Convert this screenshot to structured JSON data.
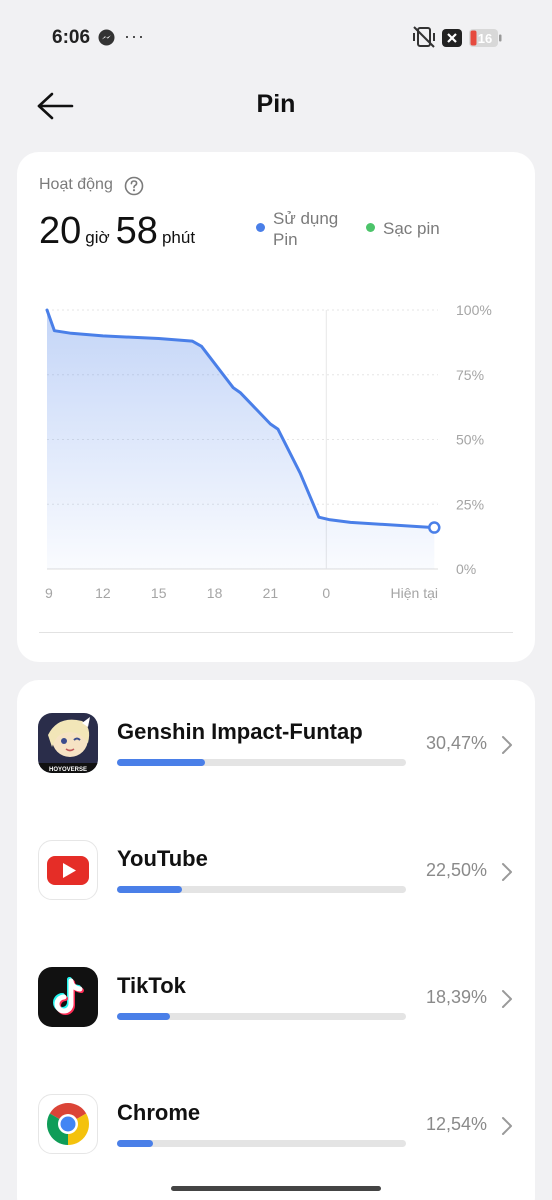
{
  "status_bar": {
    "time": "6:06",
    "icons": [
      "messenger-icon",
      "more-dots-icon",
      "vibrate-off-icon",
      "close-box-icon",
      "battery-icon"
    ],
    "battery_level": "16"
  },
  "header": {
    "title": "Pin",
    "back_icon": "arrow-left-icon"
  },
  "summary": {
    "label": "Hoạt động",
    "hours": "20",
    "hours_unit": "giờ",
    "minutes": "58",
    "minutes_unit": "phút",
    "legend": [
      {
        "label": "Sử dụng Pin",
        "color": "#4a7fe8"
      },
      {
        "label": "Sạc pin",
        "color": "#4cc46a"
      }
    ]
  },
  "chart_data": {
    "type": "area",
    "x_tick_labels": [
      "9",
      "12",
      "15",
      "18",
      "21",
      "0",
      "Hiện tại"
    ],
    "y_tick_labels": [
      "100%",
      "75%",
      "50%",
      "25%",
      "0%"
    ],
    "ylim": [
      0,
      100
    ],
    "x_hours_since_9": [
      0,
      0.4,
      1.3,
      3,
      6,
      7.8,
      8.3,
      10,
      10.4,
      12,
      12.4,
      13.6,
      14.6,
      15.2,
      16.3,
      20.8
    ],
    "values": [
      100,
      92,
      91,
      90,
      89,
      88,
      86,
      70,
      68,
      56,
      54,
      37,
      20,
      19,
      18,
      16
    ],
    "series_name": "Sử dụng Pin",
    "color": "#4a7fe8",
    "grid": true
  },
  "apps": [
    {
      "name": "Genshin Impact-Funtap",
      "percent_label": "30,47%",
      "percent": 30.47,
      "icon": "genshin-impact-icon"
    },
    {
      "name": "YouTube",
      "percent_label": "22,50%",
      "percent": 22.5,
      "icon": "youtube-icon"
    },
    {
      "name": "TikTok",
      "percent_label": "18,39%",
      "percent": 18.39,
      "icon": "tiktok-icon"
    },
    {
      "name": "Chrome",
      "percent_label": "12,54%",
      "percent": 12.54,
      "icon": "chrome-icon"
    }
  ]
}
